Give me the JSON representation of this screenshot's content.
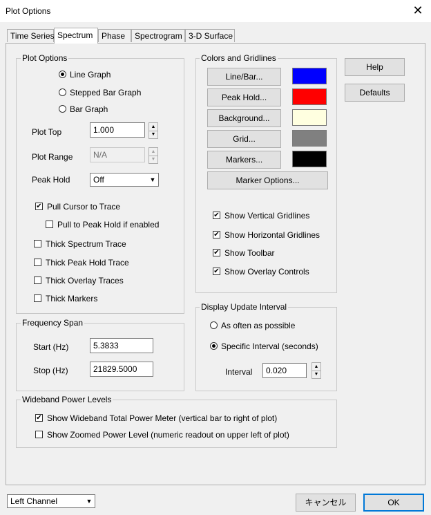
{
  "window": {
    "title": "Plot Options",
    "close_glyph": "✕"
  },
  "tabs": [
    {
      "label": "Time Series",
      "active": false
    },
    {
      "label": "Spectrum",
      "active": true
    },
    {
      "label": "Phase",
      "active": false
    },
    {
      "label": "Spectrogram",
      "active": false
    },
    {
      "label": "3-D Surface",
      "active": false
    }
  ],
  "plot_options": {
    "title": "Plot Options",
    "graph_types": [
      {
        "label": "Line Graph",
        "selected": true
      },
      {
        "label": "Stepped Bar Graph",
        "selected": false
      },
      {
        "label": "Bar Graph",
        "selected": false
      }
    ],
    "plot_top": {
      "label": "Plot Top",
      "value": "1.000"
    },
    "plot_range": {
      "label": "Plot Range",
      "value": "N/A",
      "enabled": false
    },
    "peak_hold": {
      "label": "Peak Hold",
      "value": "Off"
    },
    "checks": [
      {
        "label": "Pull Cursor to Trace",
        "checked": true
      },
      {
        "label": "Pull to Peak Hold if enabled",
        "checked": false
      },
      {
        "label": "Thick Spectrum Trace",
        "checked": false
      },
      {
        "label": "Thick Peak Hold Trace",
        "checked": false
      },
      {
        "label": "Thick Overlay Traces",
        "checked": false
      },
      {
        "label": "Thick Markers",
        "checked": false
      }
    ]
  },
  "frequency_span": {
    "title": "Frequency Span",
    "start": {
      "label": "Start (Hz)",
      "value": "5.3833"
    },
    "stop": {
      "label": "Stop (Hz)",
      "value": "21829.5000"
    }
  },
  "colors": {
    "title": "Colors and Gridlines",
    "buttons": [
      {
        "label": "Line/Bar...",
        "color": "#0000ff"
      },
      {
        "label": "Peak Hold...",
        "color": "#ff0000"
      },
      {
        "label": "Background...",
        "color": "#ffffe0"
      },
      {
        "label": "Grid...",
        "color": "#808080"
      },
      {
        "label": "Markers...",
        "color": "#000000"
      }
    ],
    "marker_options_label": "Marker Options...",
    "checks": [
      {
        "label": "Show Vertical Gridlines",
        "checked": true
      },
      {
        "label": "Show Horizontal Gridlines",
        "checked": true
      },
      {
        "label": "Show Toolbar",
        "checked": true
      },
      {
        "label": "Show Overlay Controls",
        "checked": true
      }
    ]
  },
  "update_interval": {
    "title": "Display Update Interval",
    "options": [
      {
        "label": "As often as possible",
        "selected": false
      },
      {
        "label": "Specific Interval (seconds)",
        "selected": true
      }
    ],
    "interval": {
      "label": "Interval",
      "value": "0.020"
    }
  },
  "wideband": {
    "title": "Wideband Power Levels",
    "checks": [
      {
        "label": "Show Wideband Total Power Meter (vertical bar to right of plot)",
        "checked": true
      },
      {
        "label": "Show Zoomed Power Level (numeric readout on upper left of plot)",
        "checked": false
      }
    ]
  },
  "side_buttons": {
    "help": "Help",
    "defaults": "Defaults"
  },
  "footer": {
    "channel": "Left Channel",
    "cancel": "キャンセル",
    "ok": "OK"
  },
  "glyphs": {
    "check": "✔",
    "up": "▲",
    "down": "▼"
  }
}
